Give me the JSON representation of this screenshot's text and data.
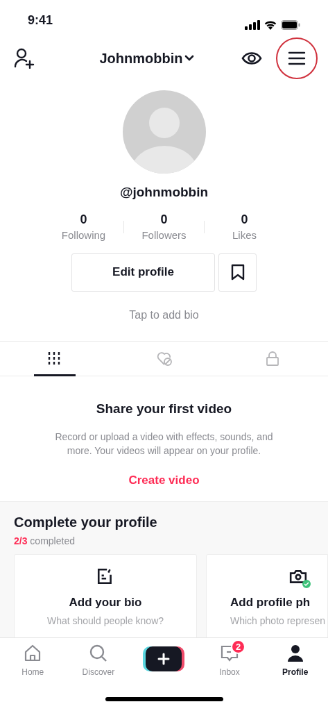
{
  "status_bar": {
    "time": "9:41"
  },
  "header": {
    "username": "Johnmobbin",
    "menu_highlighted": true
  },
  "profile": {
    "handle": "@johnmobbin",
    "bio_placeholder": "Tap to add bio"
  },
  "stats": [
    {
      "value": "0",
      "label": "Following"
    },
    {
      "value": "0",
      "label": "Followers"
    },
    {
      "value": "0",
      "label": "Likes"
    }
  ],
  "edit_button": "Edit profile",
  "tabs": [
    {
      "kind": "videos",
      "selected": true
    },
    {
      "kind": "liked",
      "selected": false
    },
    {
      "kind": "private",
      "selected": false
    }
  ],
  "empty_state": {
    "title": "Share your first video",
    "description": "Record or upload a video with effects, sounds, and more. Your videos will appear on your profile.",
    "action": "Create video"
  },
  "complete_profile": {
    "title": "Complete your profile",
    "progress": "2/3",
    "progress_suffix": "completed",
    "cards": [
      {
        "kind": "bio",
        "title": "Add your bio",
        "subtitle": "What should people know?",
        "done": false
      },
      {
        "kind": "photo",
        "title": "Add profile ph",
        "subtitle": "Which photo represen",
        "done": true
      }
    ]
  },
  "nav": [
    {
      "kind": "home",
      "label": "Home",
      "selected": false
    },
    {
      "kind": "discover",
      "label": "Discover",
      "selected": false
    },
    {
      "kind": "create"
    },
    {
      "kind": "inbox",
      "label": "Inbox",
      "selected": false,
      "badge": "2"
    },
    {
      "kind": "profile",
      "label": "Profile",
      "selected": true
    }
  ]
}
